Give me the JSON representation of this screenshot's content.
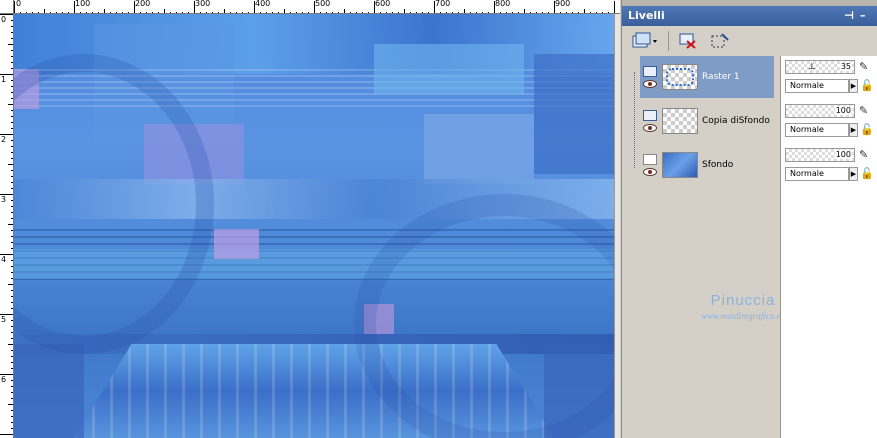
{
  "ruler": {
    "top_labels": [
      "0",
      "100",
      "200",
      "300",
      "400",
      "500",
      "600",
      "700",
      "800",
      "900"
    ],
    "left_labels": [
      "0",
      "1",
      "2",
      "3",
      "4",
      "5",
      "6"
    ]
  },
  "panel": {
    "title": "Livelli",
    "pin_glyph": "⊣",
    "close_glyph": "–"
  },
  "toolbar": {
    "new_layer_icon": "new-raster-layer-icon",
    "delete_icon": "delete-layer-icon",
    "mask_icon": "selection-icon"
  },
  "layers": [
    {
      "name": "Raster 1",
      "selected": true,
      "opacity": "35",
      "blend": "Normale"
    },
    {
      "name": "Copia diSfondo",
      "selected": false,
      "opacity": "100",
      "blend": "Normale"
    },
    {
      "name": "Sfondo",
      "selected": false,
      "opacity": "100",
      "blend": "Normale"
    }
  ],
  "watermark": {
    "name": "Pinuccia",
    "url": "www.maidiregrafica.eu"
  },
  "colors": {
    "title_bar": "#3b5f9b",
    "selection": "#7f9cc6",
    "canvas_blue": "#4d87dc"
  }
}
